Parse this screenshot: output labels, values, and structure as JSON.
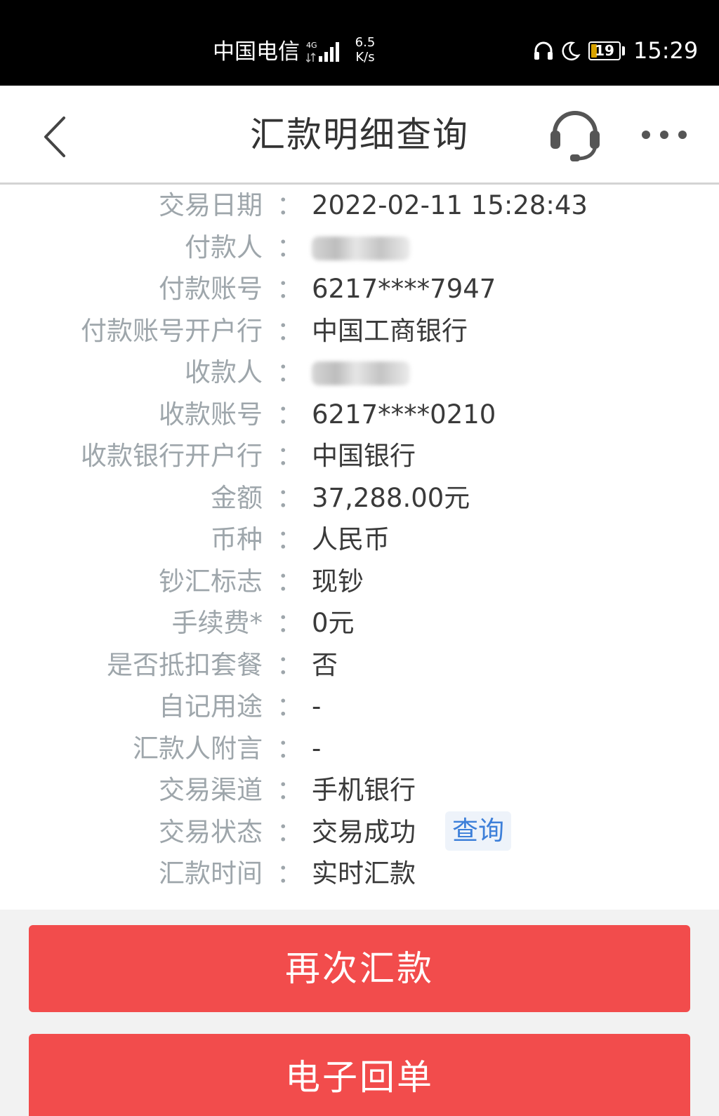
{
  "status_bar": {
    "carrier": "中国电信",
    "network_type": "4G",
    "net_speed_value": "6.5",
    "net_speed_unit": "K/s",
    "battery_percent": "19",
    "time": "15:29",
    "icons": [
      "signal-icon",
      "headset-icon",
      "moon-icon",
      "battery-icon"
    ]
  },
  "header": {
    "title": "汇款明细查询",
    "back_icon": "chevron-left-icon",
    "support_icon": "headset-icon",
    "more_icon": "more-dots-icon"
  },
  "details": [
    {
      "label": "交易日期",
      "value": "2022-02-11 15:28:43"
    },
    {
      "label": "付款人",
      "value": null,
      "blurred": true
    },
    {
      "label": "付款账号",
      "value": "6217****7947"
    },
    {
      "label": "付款账号开户行",
      "value": "中国工商银行"
    },
    {
      "label": "收款人",
      "value": null,
      "blurred": true
    },
    {
      "label": "收款账号",
      "value": "6217****0210"
    },
    {
      "label": "收款银行开户行",
      "value": "中国银行"
    },
    {
      "label": "金额",
      "value": "37,288.00元"
    },
    {
      "label": "币种",
      "value": "人民币"
    },
    {
      "label": "钞汇标志",
      "value": "现钞"
    },
    {
      "label": "手续费*",
      "value": "0元"
    },
    {
      "label": "是否抵扣套餐",
      "value": "否"
    },
    {
      "label": "自记用途",
      "value": "-"
    },
    {
      "label": "汇款人附言",
      "value": "-"
    },
    {
      "label": "交易渠道",
      "value": "手机银行"
    },
    {
      "label": "交易状态",
      "value": "交易成功",
      "link": "查询"
    },
    {
      "label": "汇款时间",
      "value": "实时汇款"
    }
  ],
  "colon": "：",
  "buttons": {
    "resend": "再次汇款",
    "receipt": "电子回单"
  },
  "colors": {
    "accent_red": "#f24c4c",
    "link_blue": "#3d7fd9",
    "label_gray": "#9ea6ab",
    "value_dark": "#3a3a3a"
  }
}
